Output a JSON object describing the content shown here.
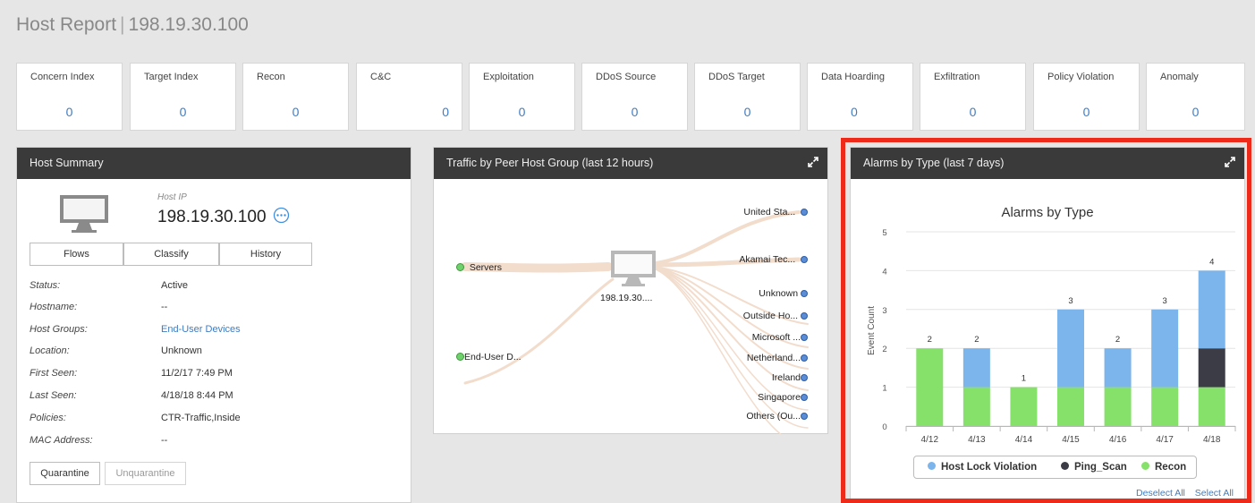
{
  "header": {
    "title": "Host Report",
    "ip": "198.19.30.100"
  },
  "tiles": [
    {
      "label": "Concern Index",
      "value": "0"
    },
    {
      "label": "Target Index",
      "value": "0"
    },
    {
      "label": "Recon",
      "value": "0"
    },
    {
      "label": "C&C",
      "value": "0"
    },
    {
      "label": "Exploitation",
      "value": "0"
    },
    {
      "label": "DDoS Source",
      "value": "0"
    },
    {
      "label": "DDoS Target",
      "value": "0"
    },
    {
      "label": "Data Hoarding",
      "value": "0"
    },
    {
      "label": "Exfiltration",
      "value": "0"
    },
    {
      "label": "Policy Violation",
      "value": "0"
    },
    {
      "label": "Anomaly",
      "value": "0"
    }
  ],
  "host_summary": {
    "title": "Host Summary",
    "host_ip_label": "Host IP",
    "host_ip": "198.19.30.100",
    "buttons": {
      "flows": "Flows",
      "classify": "Classify",
      "history": "History"
    },
    "fields": [
      {
        "label": "Status:",
        "value": "Active",
        "link": false
      },
      {
        "label": "Hostname:",
        "value": "--",
        "link": false
      },
      {
        "label": "Host Groups:",
        "value": "End-User Devices",
        "link": true
      },
      {
        "label": "Location:",
        "value": "Unknown",
        "link": false
      },
      {
        "label": "First Seen:",
        "value": "11/2/17 7:49 PM",
        "link": false
      },
      {
        "label": "Last Seen:",
        "value": "4/18/18 8:44 PM",
        "link": false
      },
      {
        "label": "Policies:",
        "value": "CTR-Traffic,Inside",
        "link": false
      },
      {
        "label": "MAC Address:",
        "value": "--",
        "link": false
      }
    ],
    "quarantine": "Quarantine",
    "unquarantine": "Unquarantine"
  },
  "traffic": {
    "title": "Traffic by Peer Host Group (last 12 hours)",
    "center_label": "198.19.30....",
    "left_nodes": [
      "Servers",
      "End-User D..."
    ],
    "right_nodes": [
      "United Sta...",
      "Akamai Tec...",
      "Unknown",
      "Outside Ho...",
      "Microsoft ...",
      "Netherland...",
      "Ireland",
      "Singapore",
      "Others (Ou..."
    ]
  },
  "alarms": {
    "panel_title": "Alarms by Type (last 7 days)",
    "deselect_all": "Deselect All",
    "select_all": "Select All"
  },
  "chart_data": {
    "type": "bar",
    "stacked": true,
    "title": "Alarms by Type",
    "ylabel": "Event Count",
    "xlabel": "",
    "ylim": [
      0,
      5
    ],
    "yticks": [
      0,
      1,
      2,
      3,
      4,
      5
    ],
    "grid": true,
    "legend_position": "bottom",
    "categories": [
      "4/12",
      "4/13",
      "4/14",
      "4/15",
      "4/16",
      "4/17",
      "4/18"
    ],
    "series": [
      {
        "name": "Recon",
        "color": "#86e16b",
        "values": [
          2,
          1,
          1,
          1,
          1,
          1,
          1
        ]
      },
      {
        "name": "Ping_Scan",
        "color": "#3c3c46",
        "values": [
          0,
          0,
          0,
          0,
          0,
          0,
          1
        ]
      },
      {
        "name": "Host Lock Violation",
        "color": "#7cb5ec",
        "values": [
          0,
          1,
          0,
          2,
          1,
          2,
          2
        ]
      }
    ],
    "legend_order": [
      "Host Lock Violation",
      "Ping_Scan",
      "Recon"
    ],
    "totals": [
      2,
      2,
      1,
      3,
      2,
      3,
      4
    ]
  }
}
